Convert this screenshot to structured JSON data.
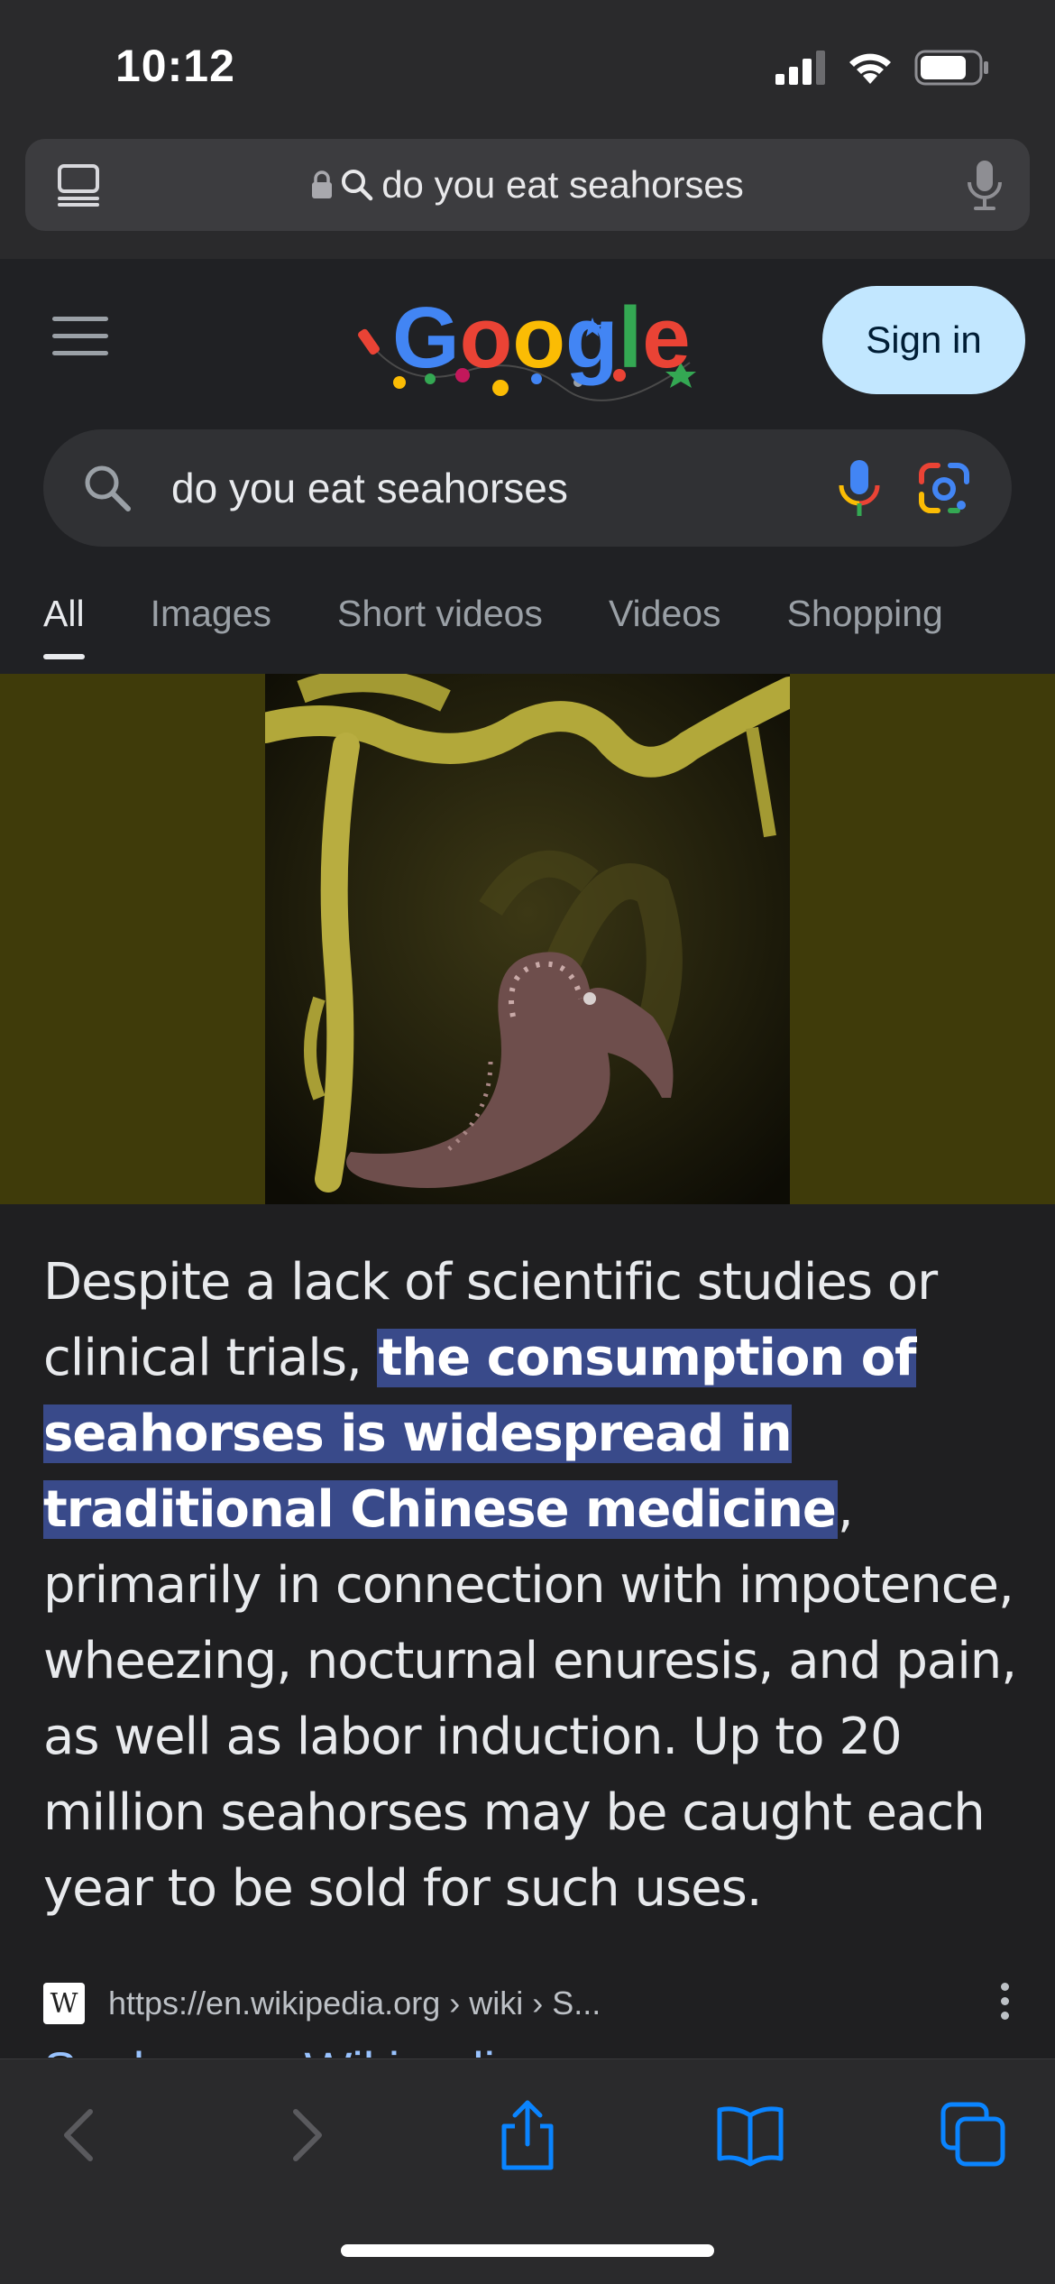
{
  "status_bar": {
    "time": "10:12"
  },
  "safari": {
    "url_text": "do you eat seahorses"
  },
  "google": {
    "sign_in_label": "Sign in",
    "search_query": "do you eat seahorses",
    "tabs": [
      {
        "label": "All",
        "active": true
      },
      {
        "label": "Images",
        "active": false
      },
      {
        "label": "Short videos",
        "active": false
      },
      {
        "label": "Videos",
        "active": false
      },
      {
        "label": "Shopping",
        "active": false
      }
    ]
  },
  "snippet": {
    "pre": "Despite a lack of scientific studies or clinical trials, ",
    "highlight": "the consumption of seahorses is widespread in traditional Chinese medicine",
    "post": ", primarily in connection with impotence, wheezing, nocturnal enuresis, and pain, as well as labor induction. Up to 20 million seahorses may be caught each year to be sold for such uses."
  },
  "source": {
    "favicon_letter": "W",
    "url": "https://en.wikipedia.org › wiki › S...",
    "title_peek": "Seahorse - Wikipedia"
  },
  "colors": {
    "accent_blue": "#0a84ff",
    "highlight_bg": "#394a8a",
    "signin_bg": "#c2e7ff"
  },
  "icons": {
    "tabs_overview": "tabs-icon",
    "lock": "lock-icon",
    "search": "search-icon",
    "mic": "mic-icon",
    "lens": "google-lens-icon",
    "menu": "hamburger-menu-icon",
    "back": "chevron-left-icon",
    "forward": "chevron-right-icon",
    "share": "share-icon",
    "bookmarks": "book-icon",
    "tabs": "tabs-overview-icon"
  }
}
